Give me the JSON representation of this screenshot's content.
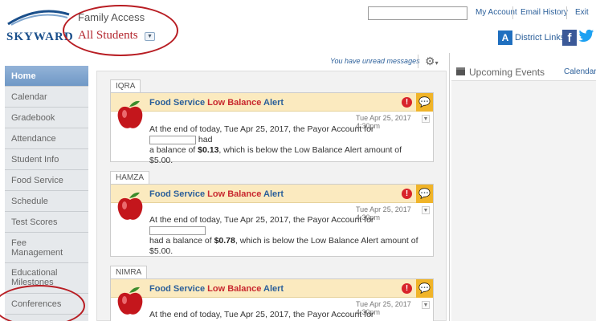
{
  "header": {
    "logo_text": "SKYWARD",
    "app_name": "Family Access",
    "student_selector": "All Students",
    "links": [
      "My Account",
      "Email History",
      "Exit"
    ],
    "district_links": "District Links"
  },
  "sidebar": {
    "items": [
      {
        "label": "Home"
      },
      {
        "label": "Calendar"
      },
      {
        "label": "Gradebook"
      },
      {
        "label": "Attendance"
      },
      {
        "label": "Student Info"
      },
      {
        "label": "Food Service"
      },
      {
        "label": "Schedule"
      },
      {
        "label": "Test Scores"
      },
      {
        "label": "Fee Management"
      },
      {
        "label": "Educational Milestones"
      },
      {
        "label": "Conferences"
      }
    ]
  },
  "messages": {
    "unread": "You have unread messages"
  },
  "alerts": [
    {
      "student": "IQRA",
      "title_pre": "Food Service ",
      "title_red": "Low Balance",
      "title_post": " Alert",
      "timestamp": "Tue Apr 25, 2017 4:30pm",
      "text_pre": "At the end of today, Tue Apr 25, 2017, the Payor Account for",
      "text_mid": "had",
      "text_bal_pre": "a balance of ",
      "balance": "$0.13",
      "text_post": ", which is below the Low Balance Alert amount of $5.00."
    },
    {
      "student": "HAMZA",
      "title_pre": "Food Service ",
      "title_red": "Low Balance",
      "title_post": " Alert",
      "timestamp": "Tue Apr 25, 2017 4:30pm",
      "text_pre": "At the end of today, Tue Apr 25, 2017, the Payor Account for",
      "text_bal_pre": "had a balance of ",
      "balance": "$0.78",
      "text_post": ", which is below the Low Balance Alert amount of",
      "text_post2": "$5.00."
    },
    {
      "student": "NIMRA",
      "title_pre": "Food Service ",
      "title_red": "Low Balance",
      "title_post": " Alert",
      "timestamp": "Tue Apr 25, 2017 4:30pm",
      "text_pre": "At the end of today, Tue Apr 25, 2017, the Payor Account for"
    }
  ],
  "events": {
    "title": "Upcoming Events",
    "calendar_link": "Calendar"
  },
  "colors": {
    "accent": "#b3252d",
    "link": "#2b5f9a",
    "alert_header": "#fbeabf",
    "home_tab": "#6f98c6"
  }
}
